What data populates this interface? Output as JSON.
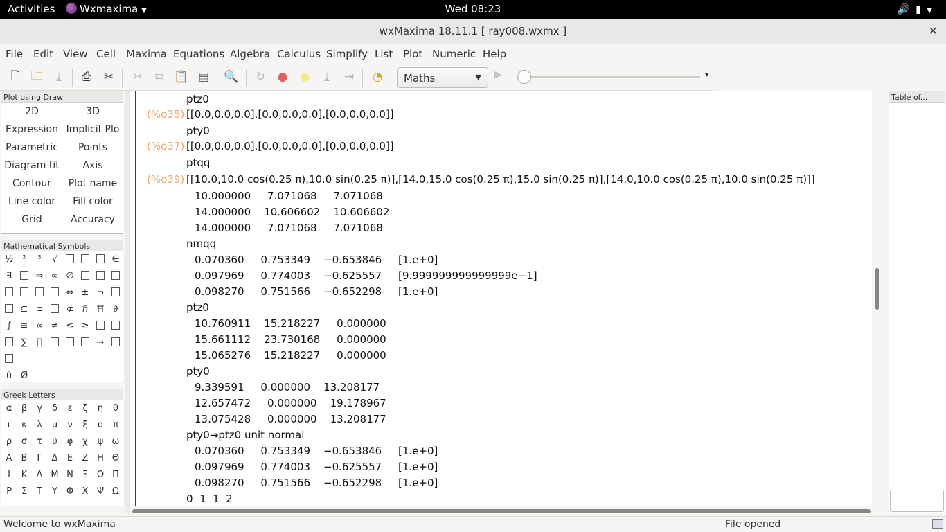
{
  "topbar": {
    "activities": "Activities",
    "app_name": "Wxmaxima",
    "clock": "Wed 08:23"
  },
  "window": {
    "title": "wxMaxima 18.11.1  [ ray008.wxmx ]"
  },
  "menu": [
    "File",
    "Edit",
    "View",
    "Cell",
    "Maxima",
    "Equations",
    "Algebra",
    "Calculus",
    "Simplify",
    "List",
    "Plot",
    "Numeric",
    "Help"
  ],
  "toolbar": {
    "cell_type": "Maths",
    "icons": [
      "new-file-icon",
      "open-file-icon",
      "save-icon",
      "print-icon",
      "settings-icon",
      "cut-icon",
      "copy-icon",
      "paste-icon",
      "copy-output-icon",
      "search-icon",
      "restart-icon",
      "interrupt-icon",
      "follow-icon",
      "step-icon",
      "skip-icon",
      "recent-icon"
    ]
  },
  "draw_panel": {
    "title": "Plot using Draw",
    "buttons": [
      "2D",
      "3D",
      "Expression",
      "Implicit Plo",
      "Parametric",
      "Points",
      "Diagram tit",
      "Axis",
      "Contour",
      "Plot name",
      "Line color",
      "Fill color",
      "Grid",
      "Accuracy"
    ]
  },
  "symbols_panel": {
    "title": "Mathematical Symbols",
    "symbols": [
      "½",
      "²",
      "³",
      "√",
      "▤",
      "▤",
      "▤",
      "∈",
      "∃",
      "▤",
      "⇒",
      "∞",
      "∅",
      "▤",
      "▤",
      "▤",
      "▤",
      "▤",
      "▤",
      "▤",
      "⇔",
      "±",
      "¬",
      "▤",
      "▤",
      "⊆",
      "⊂",
      "▤",
      "⊄",
      "ℏ",
      "Ħ",
      "∂",
      "∫",
      "≅",
      "∝",
      "≠",
      "≤",
      "≥",
      "▤",
      "▤",
      "▤",
      "∑",
      "∏",
      "▤",
      "▤",
      "▤",
      "→",
      "▤",
      "▤",
      "",
      "",
      "",
      "",
      "",
      "",
      "",
      "ü",
      "Ø"
    ]
  },
  "greek_panel": {
    "title": "Greek Letters",
    "letters": [
      "α",
      "β",
      "γ",
      "δ",
      "ε",
      "ζ",
      "η",
      "θ",
      "ι",
      "κ",
      "λ",
      "μ",
      "ν",
      "ξ",
      "ο",
      "π",
      "ρ",
      "σ",
      "τ",
      "υ",
      "φ",
      "χ",
      "ψ",
      "ω",
      "Α",
      "Β",
      "Γ",
      "Δ",
      "Ε",
      "Ζ",
      "Η",
      "Θ",
      "Ι",
      "Κ",
      "Λ",
      "Μ",
      "Ν",
      "Ξ",
      "Ο",
      "Π",
      "Ρ",
      "Σ",
      "Τ",
      "Υ",
      "Φ",
      "Χ",
      "Ψ",
      "Ω"
    ]
  },
  "worksheet": {
    "lines": [
      {
        "label": "",
        "text": "ptz0"
      },
      {
        "label": "(%o35)",
        "text": "[[0.0,0.0,0.0],[0.0,0.0,0.0],[0.0,0.0,0.0]]"
      },
      {
        "label": "",
        "text": "pty0"
      },
      {
        "label": "(%o37)",
        "text": "[[0.0,0.0,0.0],[0.0,0.0,0.0],[0.0,0.0,0.0]]"
      },
      {
        "label": "",
        "text": "ptqq"
      },
      {
        "label": "(%o39)",
        "text": "[[10.0,10.0 cos(0.25 π),10.0 sin(0.25 π)],[14.0,15.0 cos(0.25 π),15.0 sin(0.25 π)],[14.0,10.0 cos(0.25 π),10.0 sin(0.25 π)]]"
      },
      {
        "label": "",
        "text": "10.000000     7.071068     7.071068"
      },
      {
        "label": "",
        "text": "14.000000    10.606602    10.606602"
      },
      {
        "label": "",
        "text": "14.000000     7.071068     7.071068"
      },
      {
        "label": "",
        "text": "nmqq"
      },
      {
        "label": "",
        "text": "0.070360     0.753349    −0.653846     [1.e+0]"
      },
      {
        "label": "",
        "text": "0.097969     0.774003    −0.625557     [9.999999999999999e−1]"
      },
      {
        "label": "",
        "text": "0.098270     0.751566    −0.652298     [1.e+0]"
      },
      {
        "label": "",
        "text": "ptz0"
      },
      {
        "label": "",
        "text": "10.760911    15.218227     0.000000"
      },
      {
        "label": "",
        "text": "15.661112    23.730168     0.000000"
      },
      {
        "label": "",
        "text": "15.065276    15.218227     0.000000"
      },
      {
        "label": "",
        "text": "pty0"
      },
      {
        "label": "",
        "text": "9.339591     0.000000    13.208177"
      },
      {
        "label": "",
        "text": "12.657472     0.000000    19.178967"
      },
      {
        "label": "",
        "text": "13.075428     0.000000    13.208177"
      },
      {
        "label": "",
        "text": "pty0→ptz0 unit normal"
      },
      {
        "label": "",
        "text": "0.070360     0.753349    −0.653846     [1.e+0]"
      },
      {
        "label": "",
        "text": "0.097969     0.774003    −0.625557     [1.e+0]"
      },
      {
        "label": "",
        "text": "0.098270     0.751566    −0.652298     [1.e+0]"
      },
      {
        "label": "",
        "text": "0  1  1  2"
      }
    ]
  },
  "toc": {
    "title": "Table of..."
  },
  "status": {
    "left": "Welcome to wxMaxima",
    "right": "File opened"
  }
}
